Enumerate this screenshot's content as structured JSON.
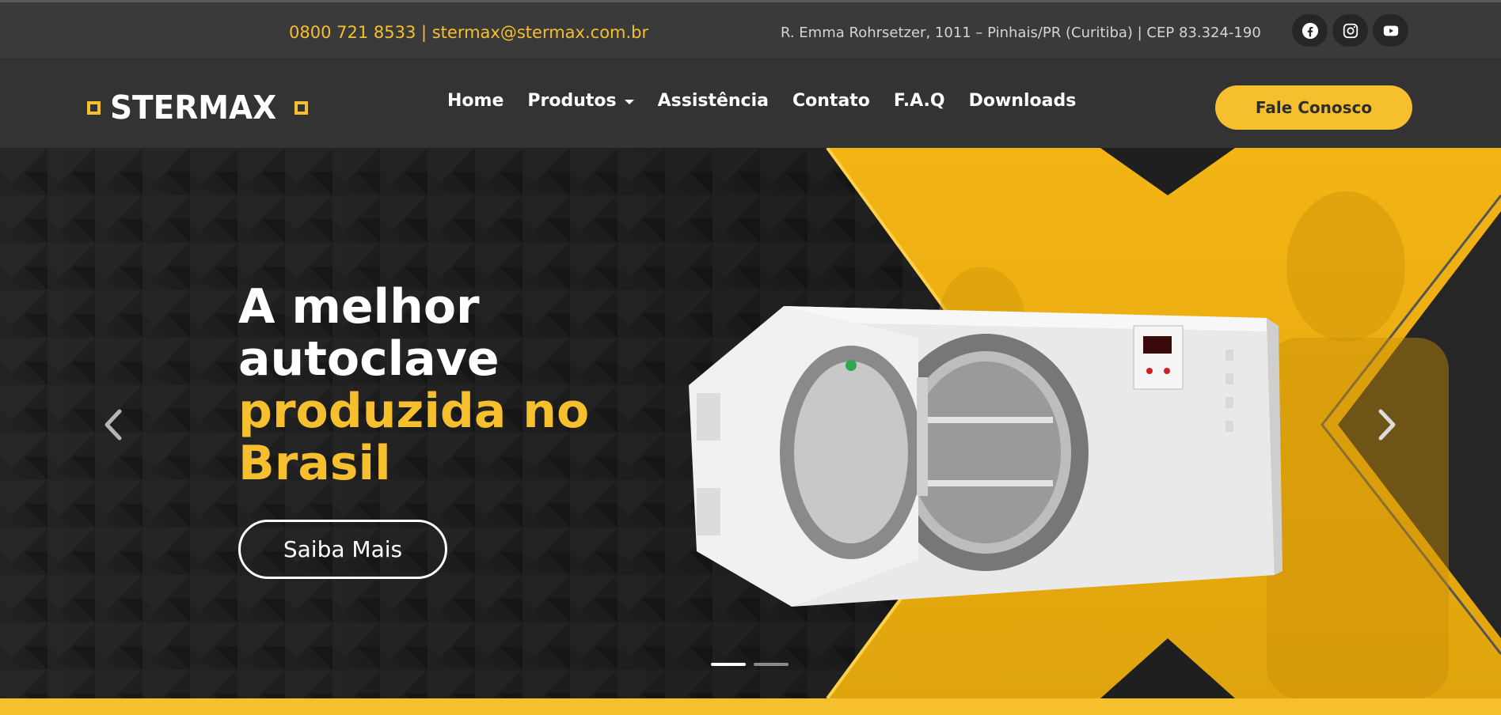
{
  "topbar": {
    "contact": "0800 721 8533 | stermax@stermax.com.br",
    "address": "R. Emma Rohrsetzer, 1011 – Pinhais/PR (Curitiba) | CEP 83.324-190",
    "social_icons": [
      "facebook-icon",
      "instagram-icon",
      "youtube-icon"
    ]
  },
  "nav": {
    "logo_text": "STERMAX",
    "items": [
      {
        "label": "Home"
      },
      {
        "label": "Produtos"
      },
      {
        "label": "Assistência"
      },
      {
        "label": "Contato"
      },
      {
        "label": "F.A.Q"
      },
      {
        "label": "Downloads"
      }
    ],
    "cta": "Fale Conosco"
  },
  "hero": {
    "headline_line1": "A melhor",
    "headline_line2": "autoclave",
    "headline_line3": "produzida no",
    "headline_line4": "Brasil",
    "button": "Saiba Mais",
    "slides_count": 2,
    "active_slide": 1,
    "icons": [
      "chevron-left-icon",
      "chevron-right-icon"
    ]
  },
  "colors": {
    "accent": "#f6bf2d",
    "topbar_bg": "#3a3a3a",
    "navbar_bg": "#333333",
    "hero_bg": "#1f1f1f"
  }
}
